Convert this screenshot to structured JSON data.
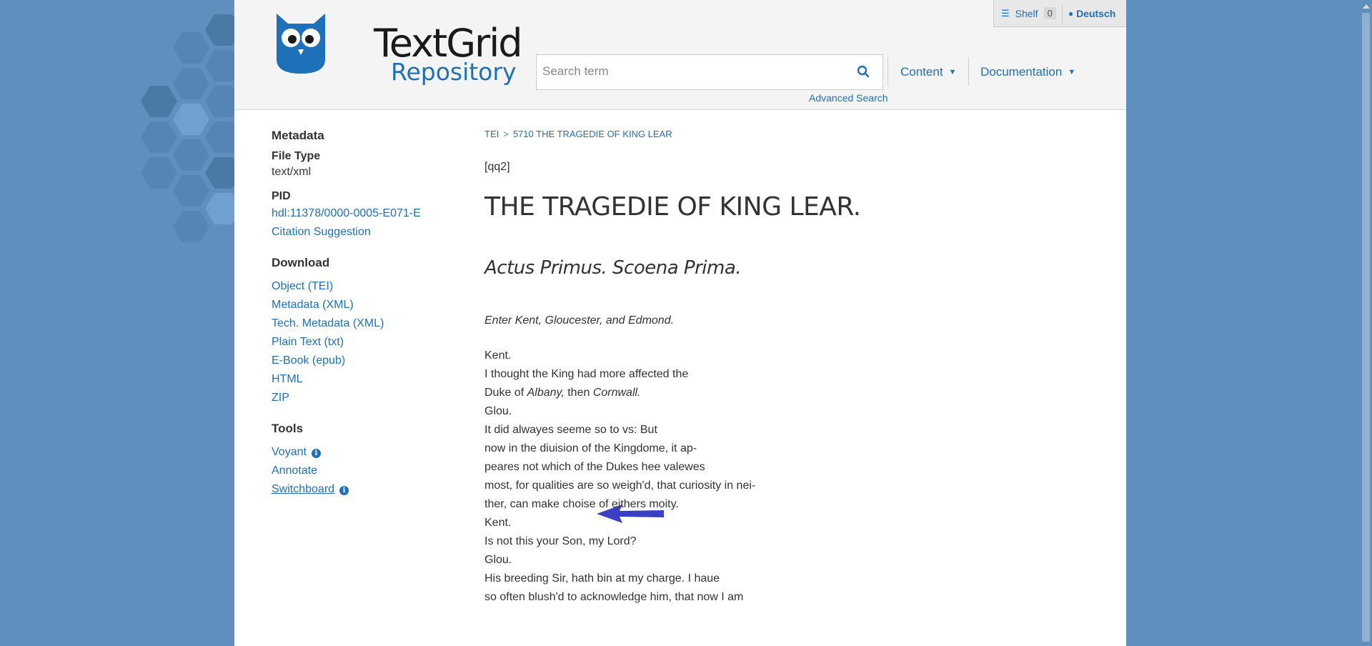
{
  "topbar": {
    "shelf_label": "Shelf",
    "shelf_count": "0",
    "language": "Deutsch"
  },
  "logo": {
    "line1": "TextGrid",
    "line2": "Repository"
  },
  "search": {
    "placeholder": "Search term",
    "advanced": "Advanced Search"
  },
  "nav": {
    "content": "Content",
    "documentation": "Documentation"
  },
  "sidebar": {
    "metadata_heading": "Metadata",
    "file_type_label": "File Type",
    "file_type_value": "text/xml",
    "pid_label": "PID",
    "pid_value": "hdl:11378/0000-0005-E071-E",
    "citation": "Citation Suggestion",
    "download_heading": "Download",
    "downloads": [
      "Object (TEI)",
      "Metadata (XML)",
      "Tech. Metadata (XML)",
      "Plain Text (txt)",
      "E-Book (epub)",
      "HTML",
      "ZIP"
    ],
    "tools_heading": "Tools",
    "tools": [
      "Voyant",
      "Annotate",
      "Switchboard"
    ]
  },
  "breadcrumb": [
    "TEI",
    "5710 THE TRAGEDIE OF KING LEAR"
  ],
  "text": {
    "qq": "[qq2]",
    "title": "THE TRAGEDIE OF KING LEAR.",
    "act": "Actus Primus. Scoena Prima.",
    "stage": "Enter Kent, Gloucester, and Edmond.",
    "line1": "Kent.",
    "line2": "I thought the King had more affected the",
    "line3_pre": "Duke of ",
    "line3_albany": "Albany,",
    "line3_mid": " then ",
    "line3_cornwall": "Cornwall.",
    "line4": "Glou.",
    "line5": "It did alwayes seeme so to vs: But",
    "line6": "now in the diuision of the Kingdome, it ap-",
    "line7": "peares not which of the Dukes hee valewes",
    "line8": "most, for qualities are so weigh'd, that curiosity in nei-",
    "line9": "ther, can make choise of eithers moity.",
    "line10": "Kent.",
    "line11": "Is not this your Son, my Lord?",
    "line12": "Glou.",
    "line13": "His breeding Sir, hath bin at my charge. I haue",
    "line14": "so often blush'd to acknowledge him, that now I am"
  },
  "colors": {
    "background": "#5e8fbd",
    "link": "#1e70b8",
    "arrow": "#3b3fc4"
  }
}
